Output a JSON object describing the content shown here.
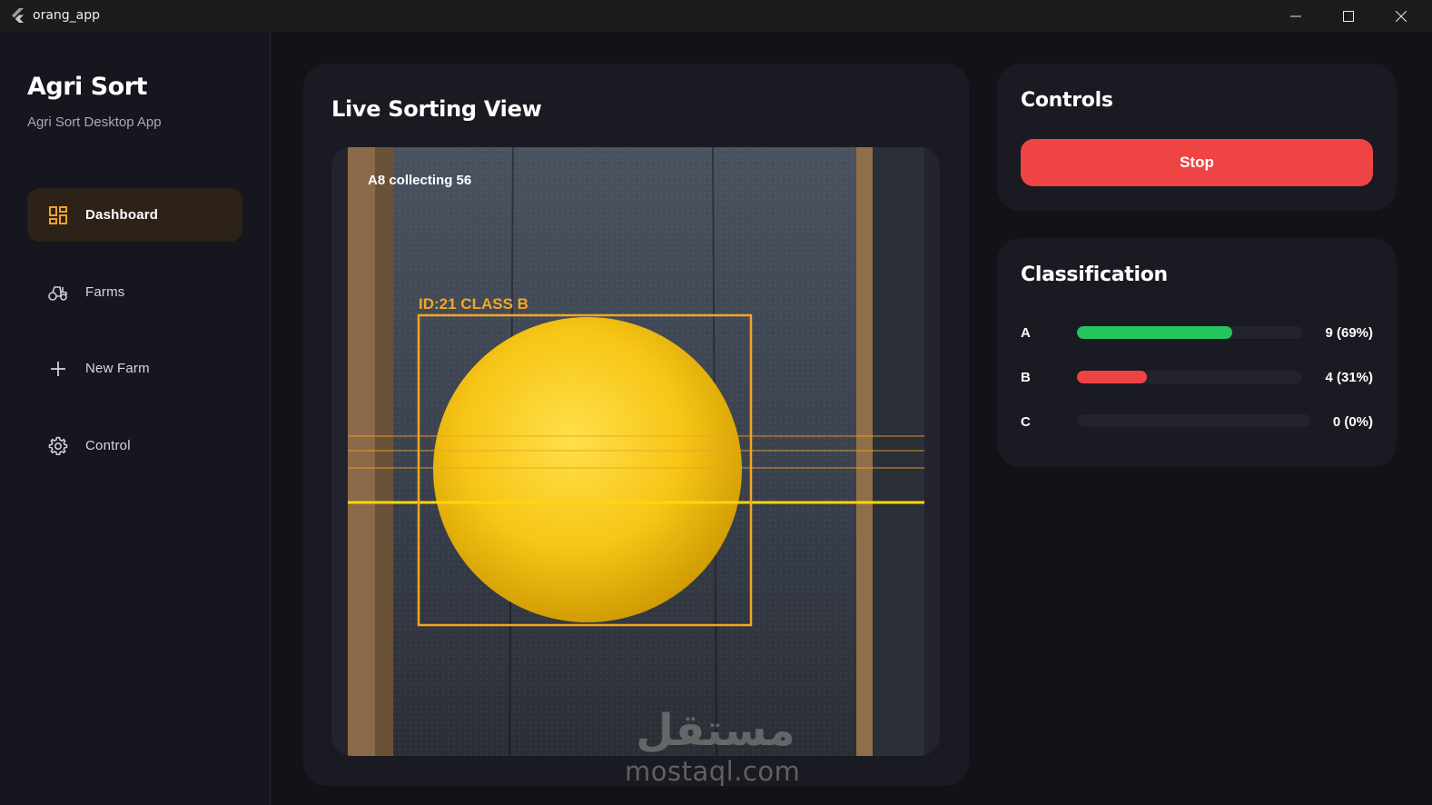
{
  "window": {
    "title": "orang_app",
    "controls": [
      "minimize-icon",
      "maximize-icon",
      "close-icon"
    ]
  },
  "sidebar": {
    "brand_title": "Agri Sort",
    "brand_subtitle": "Agri Sort Desktop App",
    "items": [
      {
        "label": "Dashboard",
        "icon": "dashboard-icon",
        "active": true
      },
      {
        "label": "Farms",
        "icon": "tractor-icon",
        "active": false
      },
      {
        "label": "New Farm",
        "icon": "plus-icon",
        "active": false
      },
      {
        "label": "Control",
        "icon": "gear-icon",
        "active": false
      }
    ]
  },
  "live_view": {
    "title": "Live Sorting View",
    "overlay_text": "A8 collecting 56",
    "detection_label": "ID:21  CLASS  B"
  },
  "controls": {
    "title": "Controls",
    "stop_label": "Stop"
  },
  "classification": {
    "title": "Classification",
    "rows": [
      {
        "label": "A",
        "value_text": "9 (69%)",
        "fraction": 0.69,
        "color": "#22c55e"
      },
      {
        "label": "B",
        "value_text": "4 (31%)",
        "fraction": 0.31,
        "color": "#ef4444"
      },
      {
        "label": "C",
        "value_text": "0 (0%)",
        "fraction": 0.0,
        "color": "#6b7280"
      }
    ]
  },
  "watermark": {
    "arabic": "مستقل",
    "latin": "mostaql.com"
  },
  "colors": {
    "accent": "#f0a22a",
    "active_nav_bg": "#2d2218",
    "stop": "#ef4444"
  }
}
